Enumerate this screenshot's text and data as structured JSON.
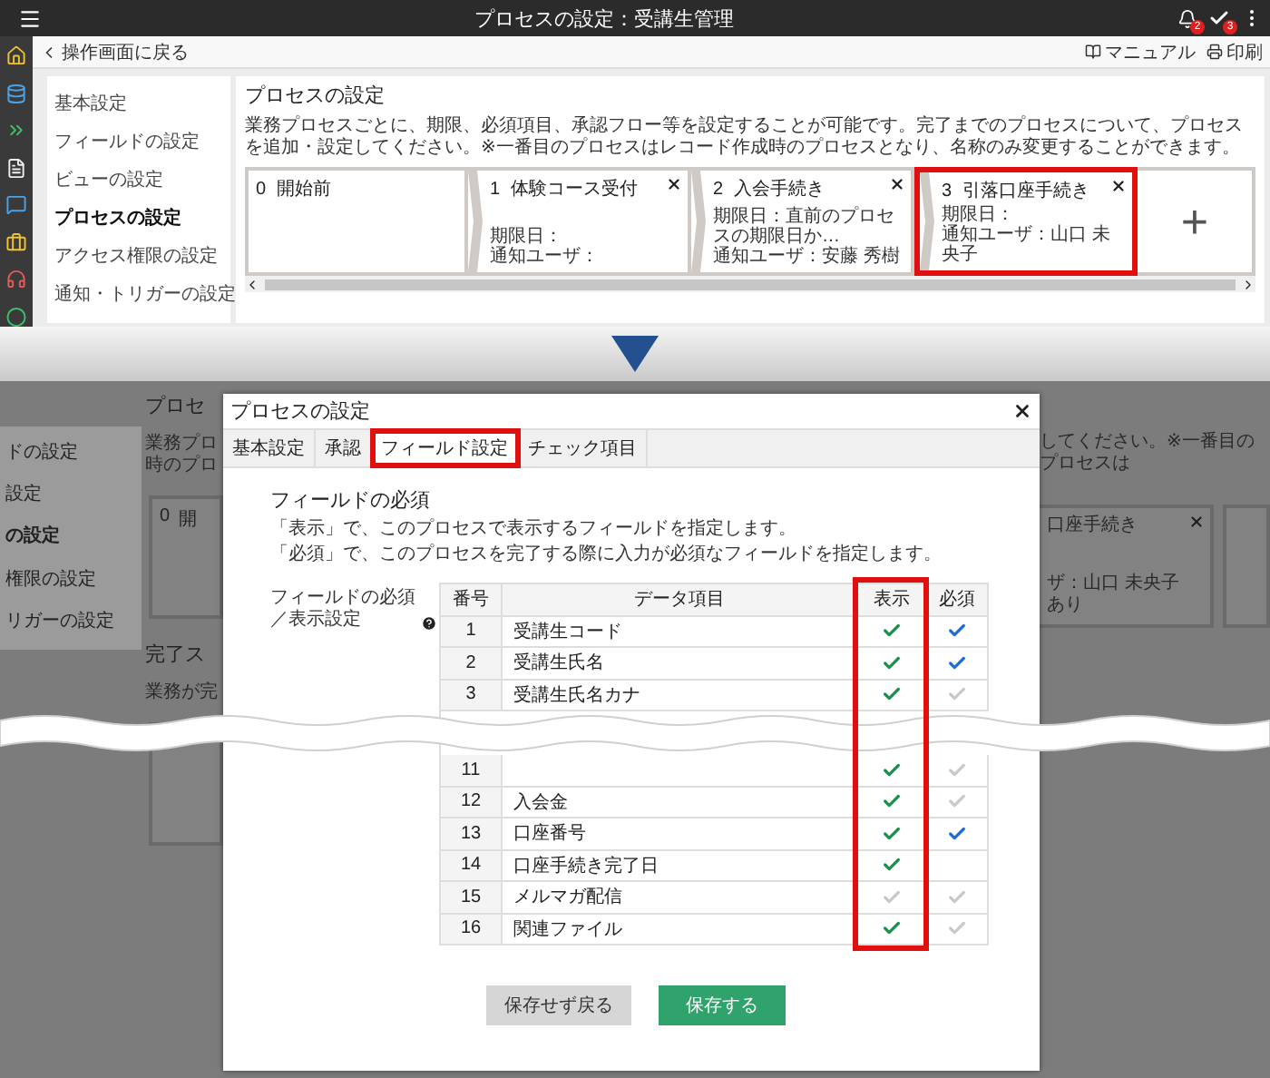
{
  "top_screen": {
    "header": {
      "title": "プロセスの設定：受講生管理",
      "notification_count": "2",
      "task_count": "3"
    },
    "back_link": "操作画面に戻る",
    "toolbar_links": [
      "マニュアル",
      "印刷"
    ],
    "nav": [
      {
        "label": "基本設定",
        "selected": false
      },
      {
        "label": "フィールドの設定",
        "selected": false
      },
      {
        "label": "ビューの設定",
        "selected": false
      },
      {
        "label": "プロセスの設定",
        "selected": true
      },
      {
        "label": "アクセス権限の設定",
        "selected": false
      },
      {
        "label": "通知・トリガーの設定",
        "selected": false
      }
    ],
    "panel": {
      "title": "プロセスの設定",
      "description": "業務プロセスごとに、期限、必須項目、承認フロー等を設定することが可能です。完了までのプロセスについて、プロセスを追加・設定してください。※一番目のプロセスはレコード作成時のプロセスとなり、名称のみ変更することができます。",
      "steps": [
        {
          "number": "0",
          "name": "開始前",
          "removable": false,
          "highlighted": false
        },
        {
          "number": "1",
          "name": "体験コース受付",
          "removable": true,
          "highlighted": false,
          "deadline": "期限日：",
          "notify": "通知ユーザ："
        },
        {
          "number": "2",
          "name": "入会手続き",
          "removable": true,
          "highlighted": false,
          "deadline": "期限日：直前のプロセスの期限日か…",
          "notify": "通知ユーザ：安藤 秀樹"
        },
        {
          "number": "3",
          "name": "引落口座手続き",
          "removable": true,
          "highlighted": true,
          "deadline": "期限日：",
          "notify": "通知ユーザ：山口 未央子"
        }
      ],
      "add_button": "+"
    }
  },
  "background_screen": {
    "nav": [
      {
        "label": "ドの設定",
        "selected": false
      },
      {
        "label": "設定",
        "selected": false
      },
      {
        "label": "の設定",
        "selected": true
      },
      {
        "label": "権限の設定",
        "selected": false
      },
      {
        "label": "リガーの設定",
        "selected": false
      }
    ],
    "left_texts": {
      "heading": "プロセ",
      "line_1": "業務プロ",
      "line_2": "時のプロ",
      "step_number": "0",
      "step_name": "開",
      "section_heading": "完了ス",
      "section_line": "業務が完"
    },
    "right_texts": {
      "description": "してください。※一番目のプロセスは",
      "step_name": "口座手続き",
      "notify": "ザ：山口 未央子",
      "extra": "あり"
    }
  },
  "dialog": {
    "title": "プロセスの設定",
    "tabs": [
      {
        "label": "基本設定",
        "selected": false,
        "highlighted": false
      },
      {
        "label": "承認",
        "selected": false,
        "highlighted": false
      },
      {
        "label": "フィールド設定",
        "selected": true,
        "highlighted": true
      },
      {
        "label": "チェック項目",
        "selected": false,
        "highlighted": false
      }
    ],
    "section_title": "フィールドの必須",
    "hints": [
      "「表示」で、このプロセスで表示するフィールドを指定します。",
      "「必須」で、このプロセスを完了する際に入力が必須なフィールドを指定します。"
    ],
    "setting_label": "フィールドの必須／表示設定",
    "columns": [
      {
        "label": "番号",
        "highlighted": false
      },
      {
        "label": "データ項目",
        "highlighted": false
      },
      {
        "label": "表示",
        "highlighted": true
      },
      {
        "label": "必須",
        "highlighted": false
      }
    ],
    "rows": [
      {
        "number": "1",
        "name": "受講生コード",
        "display": true,
        "required": true
      },
      {
        "number": "2",
        "name": "受講生氏名",
        "display": true,
        "required": true
      },
      {
        "number": "3",
        "name": "受講生氏名カナ",
        "display": true,
        "required": false
      },
      {
        "number": "11",
        "display": true,
        "required": false,
        "cut_before": true
      },
      {
        "number": "12",
        "name": "入会金",
        "display": true,
        "required": false
      },
      {
        "number": "13",
        "name": "口座番号",
        "display": true,
        "required": true
      },
      {
        "number": "14",
        "name": "口座手続き完了日",
        "display": true
      },
      {
        "number": "15",
        "name": "メルマガ配信",
        "display": false,
        "required": false
      },
      {
        "number": "16",
        "name": "関連ファイル",
        "display": true,
        "required": false
      }
    ],
    "buttons": [
      {
        "label": "保存せず戻る",
        "kind": "secondary"
      },
      {
        "label": "保存する",
        "kind": "primary"
      }
    ]
  }
}
